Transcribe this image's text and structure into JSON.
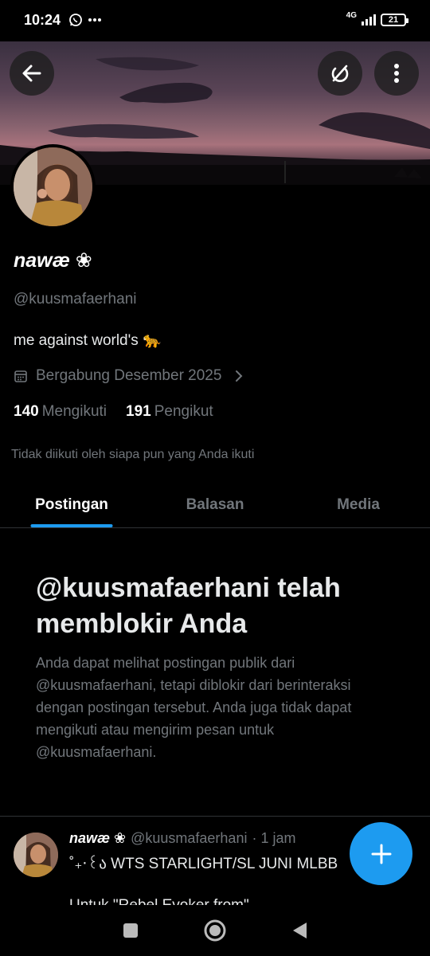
{
  "status_bar": {
    "time": "10:24",
    "network": "4G",
    "battery": "21"
  },
  "profile": {
    "name": "nawæ ❀",
    "handle": "@kuusmafaerhani",
    "bio": "me against world's 🐆",
    "joined": "Bergabung Desember 2025",
    "following_count": "140",
    "following_label": "Mengikuti",
    "followers_count": "191",
    "followers_label": "Pengikut",
    "not_followed": "Tidak diikuti oleh siapa pun yang Anda ikuti"
  },
  "tabs": [
    {
      "label": "Postingan",
      "active": true
    },
    {
      "label": "Balasan",
      "active": false
    },
    {
      "label": "Media",
      "active": false
    }
  ],
  "blocked": {
    "title": "@kuusmafaerhani telah memblokir Anda",
    "description": "Anda dapat melihat postingan publik dari @kuusmafaerhani, tetapi diblokir dari berinteraksi dengan postingan tersebut. Anda juga tidak dapat mengikuti atau mengirim pesan untuk @kuusmafaerhani."
  },
  "post": {
    "name": "nawæ ❀",
    "handle": "@kuusmafaerhani",
    "time": "· 1 jam",
    "text": "˚₊‧꒰ა  WTS STARLIGHT/SL JUNI MLBB",
    "text2": "Untuk \"Rebel Evoker from\""
  },
  "colors": {
    "accent": "#1d9bf0",
    "background": "#000000",
    "muted": "#71767b"
  },
  "icons": {
    "back": "arrow-left-icon",
    "grok": "grok-icon",
    "more": "more-vertical-icon",
    "calendar": "calendar-icon",
    "chevron": "chevron-right-icon",
    "fab": "plus-icon"
  }
}
